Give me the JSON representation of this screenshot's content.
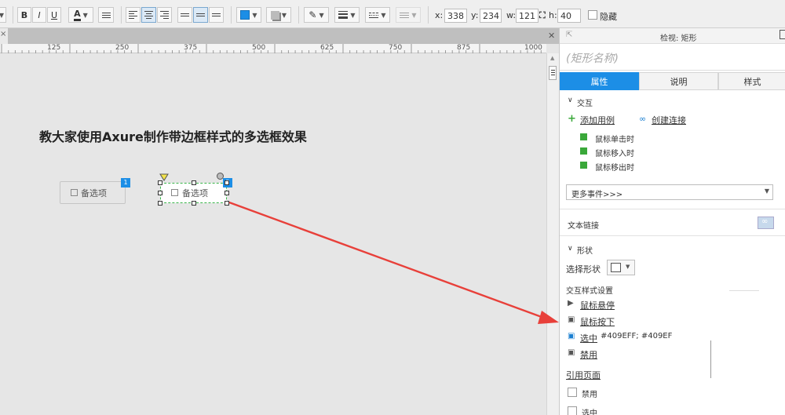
{
  "toolbar": {
    "bold": "B",
    "italic": "I",
    "underline": "U",
    "font_color": "A",
    "x_label": "x:",
    "x_value": "338",
    "y_label": "y:",
    "y_value": "234",
    "w_label": "w:",
    "w_value": "121",
    "h_label": "h:",
    "h_value": "40",
    "hidden_label": "隐藏",
    "fill_color": "#1c8ee6"
  },
  "ruler": {
    "ticks": [
      "125",
      "250",
      "375",
      "500",
      "625",
      "750",
      "875",
      "1000"
    ]
  },
  "canvas": {
    "title": "教大家使用Axure制作带边框样式的多选框效果",
    "checkbox1_label": "备选项",
    "checkbox1_badge": "1",
    "checkbox2_label": "备选项",
    "checkbox2_badge": "2"
  },
  "panel": {
    "header_title": "检视: 矩形",
    "shape_name_placeholder": "(矩形名称)",
    "tabs": [
      "属性",
      "说明",
      "样式"
    ],
    "interaction_section": "交互",
    "add_case": "添加用例",
    "create_link": "创建连接",
    "events": [
      "鼠标单击时",
      "鼠标移入时",
      "鼠标移出时"
    ],
    "more_events": "更多事件>>>",
    "text_link": "文本链接",
    "shape_section": "形状",
    "select_shape": "选择形状",
    "interaction_styles": "交互样式设置",
    "mouse_hover": "鼠标悬停",
    "mouse_down": "鼠标按下",
    "selected": "选中",
    "selected_value": "#409EFF; #409EF",
    "disabled": "禁用",
    "reference_page": "引用页面",
    "disabled_check": "禁用",
    "selected_check": "选中"
  },
  "colors": {
    "accent": "#1c8ee6",
    "arrow": "#e8403a",
    "link": "#1a7fd1"
  }
}
